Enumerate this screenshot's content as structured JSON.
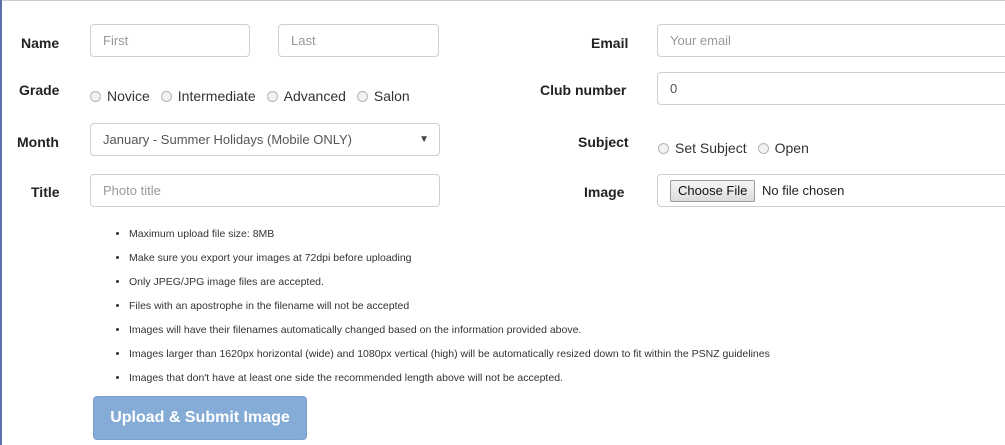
{
  "form": {
    "name": {
      "label": "Name",
      "first_placeholder": "First",
      "last_placeholder": "Last"
    },
    "email": {
      "label": "Email",
      "placeholder": "Your email"
    },
    "grade": {
      "label": "Grade",
      "options": [
        "Novice",
        "Intermediate",
        "Advanced",
        "Salon"
      ]
    },
    "club_number": {
      "label": "Club number",
      "value": "0"
    },
    "month": {
      "label": "Month",
      "selected": "January - Summer Holidays (Mobile ONLY)",
      "caret_icon": "chevron-down-icon"
    },
    "subject": {
      "label": "Subject",
      "options": [
        "Set Subject",
        "Open"
      ]
    },
    "title": {
      "label": "Title",
      "placeholder": "Photo title"
    },
    "image": {
      "label": "Image",
      "button_label": "Choose File",
      "status": "No file chosen"
    },
    "notes": [
      "Maximum upload file size: 8MB",
      "Make sure you export your images at 72dpi before uploading",
      "Only JPEG/JPG image files are accepted.",
      "Files with an apostrophe in the filename will not be accepted",
      "Images will have their filenames automatically changed based on the information provided above.",
      "Images larger than 1620px horizontal (wide) and 1080px vertical (high) will be automatically resized down to fit within the PSNZ guidelines",
      "Images that don't have at least one side the recommended length above will not be accepted."
    ],
    "submit_label": "Upload & Submit Image"
  },
  "colors": {
    "submit_button": "#84acd6",
    "frame_border": "#5b6fa8"
  }
}
